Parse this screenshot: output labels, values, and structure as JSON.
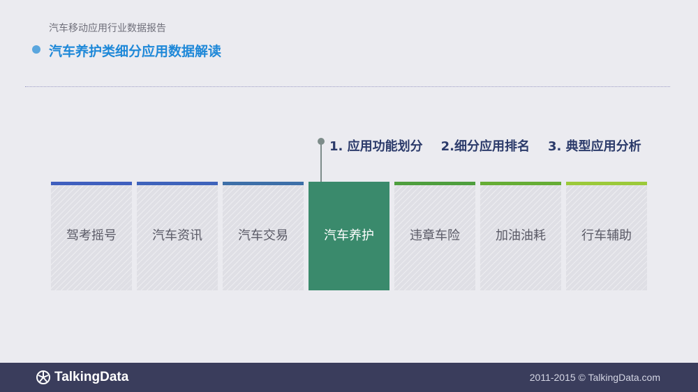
{
  "header": {
    "report_title": "汽车移动应用行业数据报告",
    "section_title": "汽车养护类细分应用数据解读"
  },
  "steps": [
    {
      "label": "1. 应用功能划分"
    },
    {
      "label": "2.细分应用排名"
    },
    {
      "label": "3. 典型应用分析"
    }
  ],
  "categories": [
    {
      "label": "驾考摇号",
      "bar_color": "#3f5fbe",
      "active": false
    },
    {
      "label": "汽车资讯",
      "bar_color": "#3e63bb",
      "active": false
    },
    {
      "label": "汽车交易",
      "bar_color": "#3d6fa8",
      "active": false
    },
    {
      "label": "汽车养护",
      "bar_color": "#3a8a6c",
      "active": true
    },
    {
      "label": "违章车险",
      "bar_color": "#4e9e3e",
      "active": false
    },
    {
      "label": "加油油耗",
      "bar_color": "#66ad35",
      "active": false
    },
    {
      "label": "行车辅助",
      "bar_color": "#9bc93a",
      "active": false
    }
  ],
  "colors": {
    "background": "#ebebf0",
    "accent_blue": "#1e88d8",
    "active_card": "#3a8a6c",
    "footer": "#3a3d5c"
  },
  "footer": {
    "logo_text": "TalkingData",
    "logo_icon": "talkingdata-logo-icon",
    "copyright": "2011-2015 © TalkingData.com"
  }
}
